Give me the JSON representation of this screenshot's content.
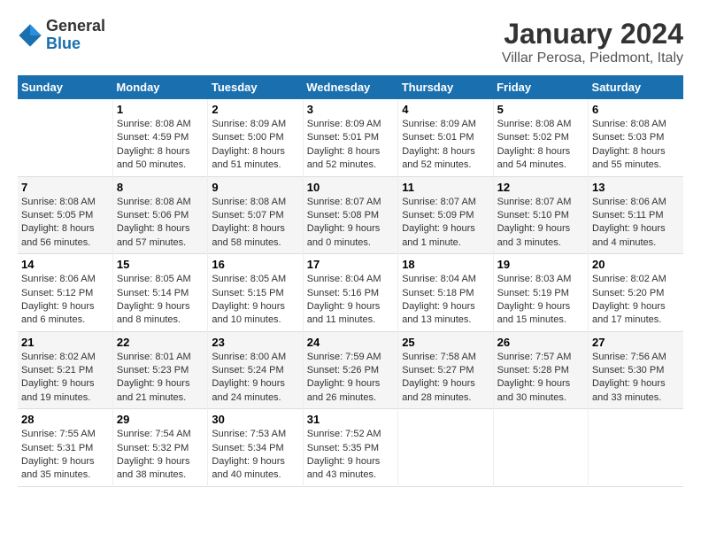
{
  "header": {
    "logo": {
      "general": "General",
      "blue": "Blue"
    },
    "month": "January 2024",
    "location": "Villar Perosa, Piedmont, Italy"
  },
  "calendar": {
    "days_of_week": [
      "Sunday",
      "Monday",
      "Tuesday",
      "Wednesday",
      "Thursday",
      "Friday",
      "Saturday"
    ],
    "weeks": [
      [
        {
          "day": "",
          "info": ""
        },
        {
          "day": "1",
          "info": "Sunrise: 8:08 AM\nSunset: 4:59 PM\nDaylight: 8 hours\nand 50 minutes."
        },
        {
          "day": "2",
          "info": "Sunrise: 8:09 AM\nSunset: 5:00 PM\nDaylight: 8 hours\nand 51 minutes."
        },
        {
          "day": "3",
          "info": "Sunrise: 8:09 AM\nSunset: 5:01 PM\nDaylight: 8 hours\nand 52 minutes."
        },
        {
          "day": "4",
          "info": "Sunrise: 8:09 AM\nSunset: 5:01 PM\nDaylight: 8 hours\nand 52 minutes."
        },
        {
          "day": "5",
          "info": "Sunrise: 8:08 AM\nSunset: 5:02 PM\nDaylight: 8 hours\nand 54 minutes."
        },
        {
          "day": "6",
          "info": "Sunrise: 8:08 AM\nSunset: 5:03 PM\nDaylight: 8 hours\nand 55 minutes."
        }
      ],
      [
        {
          "day": "7",
          "info": "Sunrise: 8:08 AM\nSunset: 5:05 PM\nDaylight: 8 hours\nand 56 minutes."
        },
        {
          "day": "8",
          "info": "Sunrise: 8:08 AM\nSunset: 5:06 PM\nDaylight: 8 hours\nand 57 minutes."
        },
        {
          "day": "9",
          "info": "Sunrise: 8:08 AM\nSunset: 5:07 PM\nDaylight: 8 hours\nand 58 minutes."
        },
        {
          "day": "10",
          "info": "Sunrise: 8:07 AM\nSunset: 5:08 PM\nDaylight: 9 hours\nand 0 minutes."
        },
        {
          "day": "11",
          "info": "Sunrise: 8:07 AM\nSunset: 5:09 PM\nDaylight: 9 hours\nand 1 minute."
        },
        {
          "day": "12",
          "info": "Sunrise: 8:07 AM\nSunset: 5:10 PM\nDaylight: 9 hours\nand 3 minutes."
        },
        {
          "day": "13",
          "info": "Sunrise: 8:06 AM\nSunset: 5:11 PM\nDaylight: 9 hours\nand 4 minutes."
        }
      ],
      [
        {
          "day": "14",
          "info": "Sunrise: 8:06 AM\nSunset: 5:12 PM\nDaylight: 9 hours\nand 6 minutes."
        },
        {
          "day": "15",
          "info": "Sunrise: 8:05 AM\nSunset: 5:14 PM\nDaylight: 9 hours\nand 8 minutes."
        },
        {
          "day": "16",
          "info": "Sunrise: 8:05 AM\nSunset: 5:15 PM\nDaylight: 9 hours\nand 10 minutes."
        },
        {
          "day": "17",
          "info": "Sunrise: 8:04 AM\nSunset: 5:16 PM\nDaylight: 9 hours\nand 11 minutes."
        },
        {
          "day": "18",
          "info": "Sunrise: 8:04 AM\nSunset: 5:18 PM\nDaylight: 9 hours\nand 13 minutes."
        },
        {
          "day": "19",
          "info": "Sunrise: 8:03 AM\nSunset: 5:19 PM\nDaylight: 9 hours\nand 15 minutes."
        },
        {
          "day": "20",
          "info": "Sunrise: 8:02 AM\nSunset: 5:20 PM\nDaylight: 9 hours\nand 17 minutes."
        }
      ],
      [
        {
          "day": "21",
          "info": "Sunrise: 8:02 AM\nSunset: 5:21 PM\nDaylight: 9 hours\nand 19 minutes."
        },
        {
          "day": "22",
          "info": "Sunrise: 8:01 AM\nSunset: 5:23 PM\nDaylight: 9 hours\nand 21 minutes."
        },
        {
          "day": "23",
          "info": "Sunrise: 8:00 AM\nSunset: 5:24 PM\nDaylight: 9 hours\nand 24 minutes."
        },
        {
          "day": "24",
          "info": "Sunrise: 7:59 AM\nSunset: 5:26 PM\nDaylight: 9 hours\nand 26 minutes."
        },
        {
          "day": "25",
          "info": "Sunrise: 7:58 AM\nSunset: 5:27 PM\nDaylight: 9 hours\nand 28 minutes."
        },
        {
          "day": "26",
          "info": "Sunrise: 7:57 AM\nSunset: 5:28 PM\nDaylight: 9 hours\nand 30 minutes."
        },
        {
          "day": "27",
          "info": "Sunrise: 7:56 AM\nSunset: 5:30 PM\nDaylight: 9 hours\nand 33 minutes."
        }
      ],
      [
        {
          "day": "28",
          "info": "Sunrise: 7:55 AM\nSunset: 5:31 PM\nDaylight: 9 hours\nand 35 minutes."
        },
        {
          "day": "29",
          "info": "Sunrise: 7:54 AM\nSunset: 5:32 PM\nDaylight: 9 hours\nand 38 minutes."
        },
        {
          "day": "30",
          "info": "Sunrise: 7:53 AM\nSunset: 5:34 PM\nDaylight: 9 hours\nand 40 minutes."
        },
        {
          "day": "31",
          "info": "Sunrise: 7:52 AM\nSunset: 5:35 PM\nDaylight: 9 hours\nand 43 minutes."
        },
        {
          "day": "",
          "info": ""
        },
        {
          "day": "",
          "info": ""
        },
        {
          "day": "",
          "info": ""
        }
      ]
    ]
  }
}
